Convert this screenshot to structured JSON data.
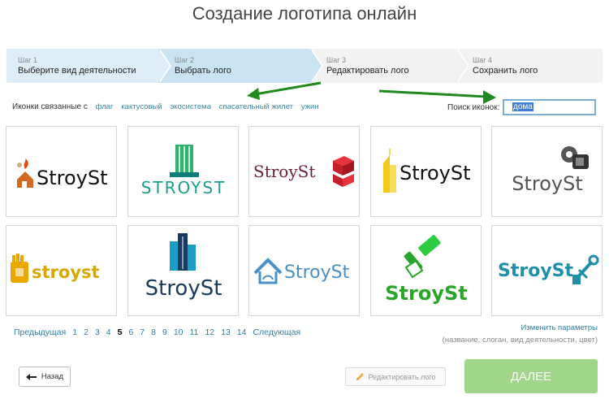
{
  "page": {
    "title": "Создание логотипа онлайн"
  },
  "steps": [
    {
      "num": "Шаг 1",
      "label": "Выберите вид деятельности"
    },
    {
      "num": "Шаг 2",
      "label": "Выбрать лого"
    },
    {
      "num": "Шаг 3",
      "label": "Редактировать лого"
    },
    {
      "num": "Шаг 4",
      "label": "Сохранить лого"
    }
  ],
  "related": {
    "label": "Иконки связанные с",
    "tags": [
      "флаг",
      "кактусовый",
      "экосистема",
      "спасательный жилет",
      "ужин"
    ]
  },
  "search": {
    "label": "Поиск иконок:",
    "value": "дома"
  },
  "logos": [
    {
      "text": "StroySt",
      "icon": "house-fire-icon",
      "color": "#111111"
    },
    {
      "text": "STROYST",
      "icon": "building-tower-icon",
      "color": "#1a9e8c"
    },
    {
      "text": "StroySt",
      "icon": "red-cubes-icon",
      "color": "#6b2033"
    },
    {
      "text": "StroySt",
      "icon": "yellow-skyscraper-icon",
      "color": "#111111"
    },
    {
      "text": "StroySt",
      "icon": "gear-cylinder-icon",
      "color": "#555555"
    },
    {
      "text": "stroyst",
      "icon": "yellow-hand-icon",
      "color": "#d9a800"
    },
    {
      "text": "StroySt",
      "icon": "city-buildings-icon",
      "color": "#173a5e"
    },
    {
      "text": "StroySt",
      "icon": "house-outline-icon",
      "color": "#4a90c8"
    },
    {
      "text": "StroySt",
      "icon": "paint-roller-icon",
      "color": "#2aa52a"
    },
    {
      "text": "StroySt",
      "icon": "wrench-pipe-icon",
      "color": "#1f8faa"
    }
  ],
  "pagination": {
    "prev": "Предыдущая",
    "pages": [
      "1",
      "2",
      "3",
      "4",
      "5",
      "6",
      "7",
      "8",
      "9",
      "10",
      "11",
      "12",
      "13",
      "14"
    ],
    "current": "5",
    "next": "Следующая"
  },
  "params": {
    "link": "Изменить параметры",
    "hint": "(название, слоган, вид деятельности, цвет)"
  },
  "buttons": {
    "back": "Назад",
    "edit": "Редактировать лого",
    "next": "ДАЛЕЕ"
  },
  "colors": {
    "accent": "#2f7fa5",
    "next_button": "#9fd68a",
    "arrow": "#1f8a1f"
  }
}
